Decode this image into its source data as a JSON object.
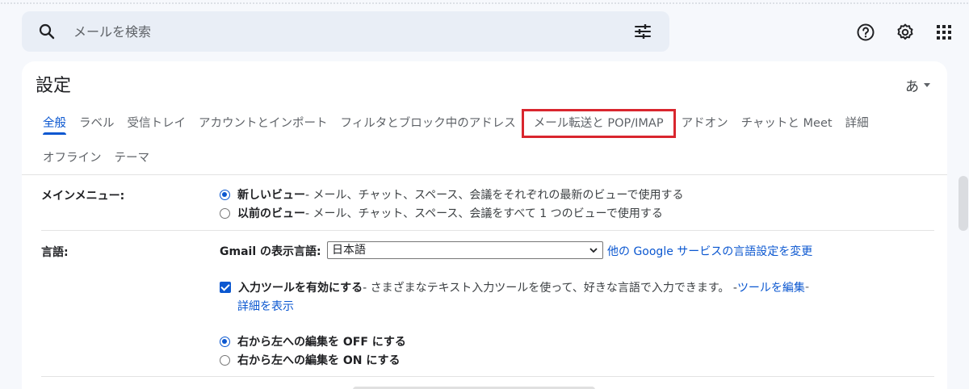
{
  "search": {
    "placeholder": "メールを検索"
  },
  "icons": {
    "search": "search-icon",
    "filter": "tune-icon",
    "help": "help-icon",
    "settings": "gear-icon",
    "apps": "apps-grid-icon"
  },
  "settings": {
    "title": "設定",
    "input_tools_label": "あ",
    "tabs_row1": [
      "全般",
      "ラベル",
      "受信トレイ",
      "アカウントとインポート",
      "フィルタとブロック中のアドレス",
      "メール転送と POP/IMAP",
      "アドオン",
      "チャットと Meet",
      "詳細"
    ],
    "tabs_row2": [
      "オフライン",
      "テーマ"
    ],
    "active_tab": "全般",
    "highlighted_tab": "メール転送と POP/IMAP"
  },
  "main_menu": {
    "label": "メインメニュー:",
    "option_new_title": "新しいビュー",
    "option_new_desc": " - メール、チャット、スペース、会議をそれぞれの最新のビューで使用する",
    "option_old_title": "以前のビュー",
    "option_old_desc": " - メール、チャット、スペース、会議をすべて 1 つのビューで使用する"
  },
  "language": {
    "label": "言語:",
    "display_label": "Gmail の表示言語:",
    "selected": "日本語",
    "google_link": "他の Google サービスの言語設定を変更",
    "input_tools_title": "入力ツールを有効にする",
    "input_tools_desc": " - さまざまなテキスト入力ツールを使って、好きな言語で入力できます。 - ",
    "edit_tools_link": "ツールを編集",
    "dash": " -",
    "show_details_link": "詳細を表示",
    "rtl_off": "右から左への編集を OFF にする",
    "rtl_on": "右から左への編集を ON にする"
  },
  "colors": {
    "accent": "#0b57d0",
    "highlight_box": "#d9262e"
  }
}
